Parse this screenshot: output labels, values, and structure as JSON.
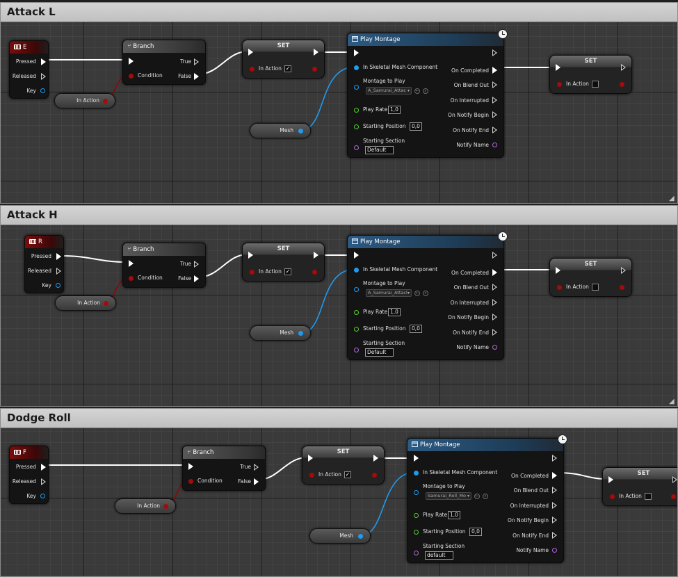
{
  "colors": {
    "exec_pin": "#ffffff",
    "bool_pin": "#a50b0b",
    "object_pin": "#1f9bf0",
    "float_pin": "#55d033",
    "name_pin": "#b06ad8",
    "event_header": "#7c0c0c",
    "montage_header": "#2c5a82",
    "comment_title_bg": "#c8c8c8"
  },
  "sections": [
    {
      "title": "Attack L",
      "event": {
        "key_name": "E",
        "pressed": "Pressed",
        "released": "Released",
        "key": "Key",
        "icon": "keyboard-icon"
      },
      "branch": {
        "title": "Branch",
        "icon": "branch-icon",
        "condition": "Condition",
        "true_label": "True",
        "false_label": "False"
      },
      "get_in_action": "In Action",
      "set1": {
        "title": "SET",
        "var_label": "In Action",
        "checked": true,
        "check_glyph": "✓"
      },
      "mesh": "Mesh",
      "montage": {
        "title": "Play Montage",
        "in_mesh": "In Skeletal Mesh Component",
        "montage_to_play": "Montage to Play",
        "montage_value": "A_Samurai_Attac",
        "play_rate": "Play Rate",
        "play_rate_value": "1,0",
        "starting_position": "Starting Position",
        "starting_position_value": "0,0",
        "starting_section": "Starting Section",
        "starting_section_value": "Default",
        "on_completed": "On Completed",
        "on_blend_out": "On Blend Out",
        "on_interrupted": "On Interrupted",
        "on_notify_begin": "On Notify Begin",
        "on_notify_end": "On Notify End",
        "notify_name": "Notify Name"
      },
      "set2": {
        "title": "SET",
        "var_label": "In Action",
        "checked": false
      }
    },
    {
      "title": "Attack H",
      "event": {
        "key_name": "R",
        "pressed": "Pressed",
        "released": "Released",
        "key": "Key",
        "icon": "keyboard-icon"
      },
      "branch": {
        "title": "Branch",
        "icon": "branch-icon",
        "condition": "Condition",
        "true_label": "True",
        "false_label": "False"
      },
      "get_in_action": "In Action",
      "set1": {
        "title": "SET",
        "var_label": "In Action",
        "checked": true,
        "check_glyph": "✓"
      },
      "mesh": "Mesh",
      "montage": {
        "title": "Play Montage",
        "in_mesh": "In Skeletal Mesh Component",
        "montage_to_play": "Montage to Play",
        "montage_value": "A_Samurai_Attacl",
        "play_rate": "Play Rate",
        "play_rate_value": "1,0",
        "starting_position": "Starting Position",
        "starting_position_value": "0,0",
        "starting_section": "Starting Section",
        "starting_section_value": "Default",
        "on_completed": "On Completed",
        "on_blend_out": "On Blend Out",
        "on_interrupted": "On Interrupted",
        "on_notify_begin": "On Notify Begin",
        "on_notify_end": "On Notify End",
        "notify_name": "Notify Name"
      },
      "set2": {
        "title": "SET",
        "var_label": "In Action",
        "checked": false
      }
    },
    {
      "title": "Dodge Roll",
      "event": {
        "key_name": "F",
        "pressed": "Pressed",
        "released": "Released",
        "key": "Key",
        "icon": "keyboard-icon"
      },
      "branch": {
        "title": "Branch",
        "icon": "branch-icon",
        "condition": "Condition",
        "true_label": "True",
        "false_label": "False"
      },
      "get_in_action": "In Action",
      "set1": {
        "title": "SET",
        "var_label": "In Action",
        "checked": true,
        "check_glyph": "✓"
      },
      "mesh": "Mesh",
      "montage": {
        "title": "Play Montage",
        "in_mesh": "In Skeletal Mesh Component",
        "montage_to_play": "Montage to Play",
        "montage_value": "Samurai_Roll_Mo",
        "play_rate": "Play Rate",
        "play_rate_value": "1,0",
        "starting_position": "Starting Position",
        "starting_position_value": "0,0",
        "starting_section": "Starting Section",
        "starting_section_value": "default",
        "on_completed": "On Completed",
        "on_blend_out": "On Blend Out",
        "on_interrupted": "On Interrupted",
        "on_notify_begin": "On Notify Begin",
        "on_notify_end": "On Notify End",
        "notify_name": "Notify Name"
      },
      "set2": {
        "title": "SET",
        "var_label": "In Action",
        "checked": false
      }
    }
  ]
}
